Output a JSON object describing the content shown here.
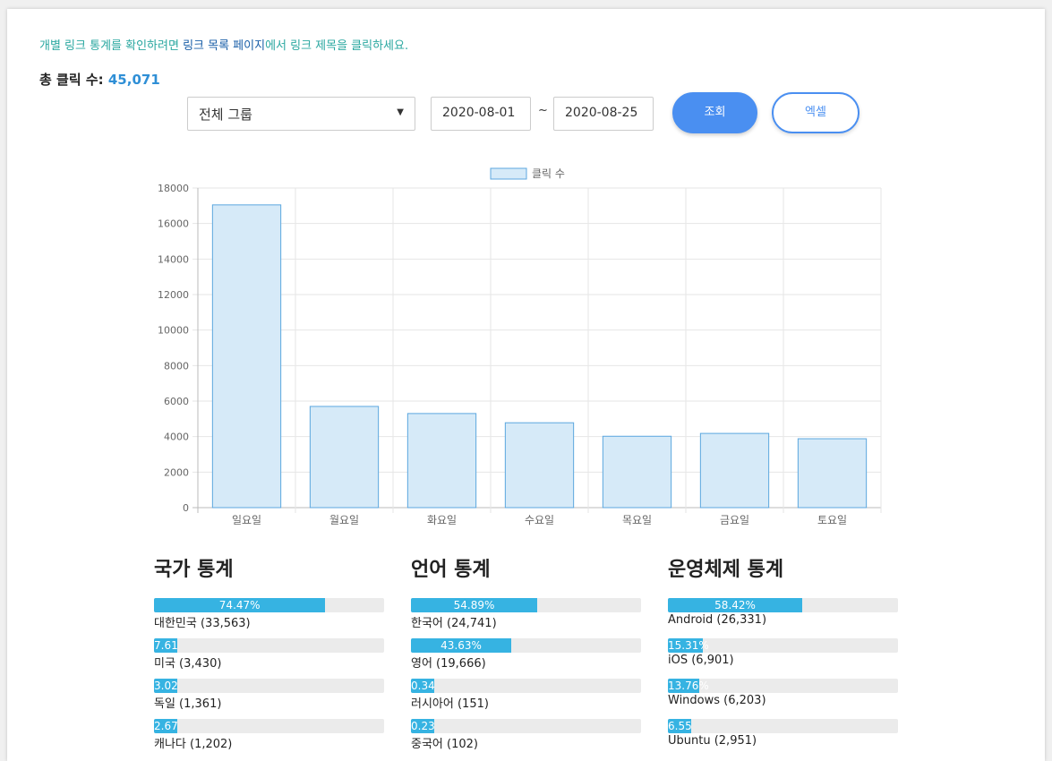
{
  "notice": {
    "before": "개별 링크 통계를 확인하려면 ",
    "link": "링크 목록 페이지",
    "after": "에서 링크 제목을 클릭하세요."
  },
  "total": {
    "label": "총 클릭 수: ",
    "value": "45,071"
  },
  "filters": {
    "group": "전체 그룹",
    "start_date": "2020-08-01",
    "separator": "~",
    "end_date": "2020-08-25",
    "search_label": "조회",
    "excel_label": "엑셀"
  },
  "chart_data": {
    "type": "bar",
    "legend": "클릭 수",
    "categories": [
      "일요일",
      "월요일",
      "화요일",
      "수요일",
      "목요일",
      "금요일",
      "토요일"
    ],
    "values": [
      17050,
      5700,
      5300,
      4780,
      4020,
      4180,
      3880
    ],
    "ylim": [
      0,
      18000
    ],
    "yticks": [
      "18000",
      "16000",
      "14000",
      "12000",
      "10000",
      "8000",
      "6000",
      "4000",
      "2000",
      "0"
    ],
    "grid": true,
    "legend_position": "top-center",
    "bar_color": "#d6eaf8",
    "bar_border": "#5ca7df"
  },
  "stats": [
    {
      "title": "국가 통계",
      "items": [
        {
          "pct": 74.47,
          "pct_label": "74.47%",
          "label": "대한민국 (33,563)"
        },
        {
          "pct": 7.61,
          "pct_label": "7.61",
          "label": "미국 (3,430)"
        },
        {
          "pct": 3.02,
          "pct_label": "3.02",
          "label": "독일 (1,361)"
        },
        {
          "pct": 2.67,
          "pct_label": "2.67",
          "label": "캐나다 (1,202)"
        }
      ]
    },
    {
      "title": "언어 통계",
      "items": [
        {
          "pct": 54.89,
          "pct_label": "54.89%",
          "label": "한국어 (24,741)"
        },
        {
          "pct": 43.63,
          "pct_label": "43.63%",
          "label": "영어 (19,666)"
        },
        {
          "pct": 0.34,
          "pct_label": "0.34",
          "label": "러시아어 (151)"
        },
        {
          "pct": 0.23,
          "pct_label": "0.23",
          "label": "중국어 (102)"
        }
      ]
    },
    {
      "title": "운영체제 통계",
      "items": [
        {
          "pct": 58.42,
          "pct_label": "58.42%",
          "label": "Android (26,331)"
        },
        {
          "pct": 15.31,
          "pct_label": "15.31%",
          "label": "iOS (6,901)"
        },
        {
          "pct": 13.76,
          "pct_label": "13.76%",
          "label": "Windows (6,203)"
        },
        {
          "pct": 6.55,
          "pct_label": "6.55",
          "label": "Ubuntu (2,951)"
        }
      ]
    }
  ]
}
